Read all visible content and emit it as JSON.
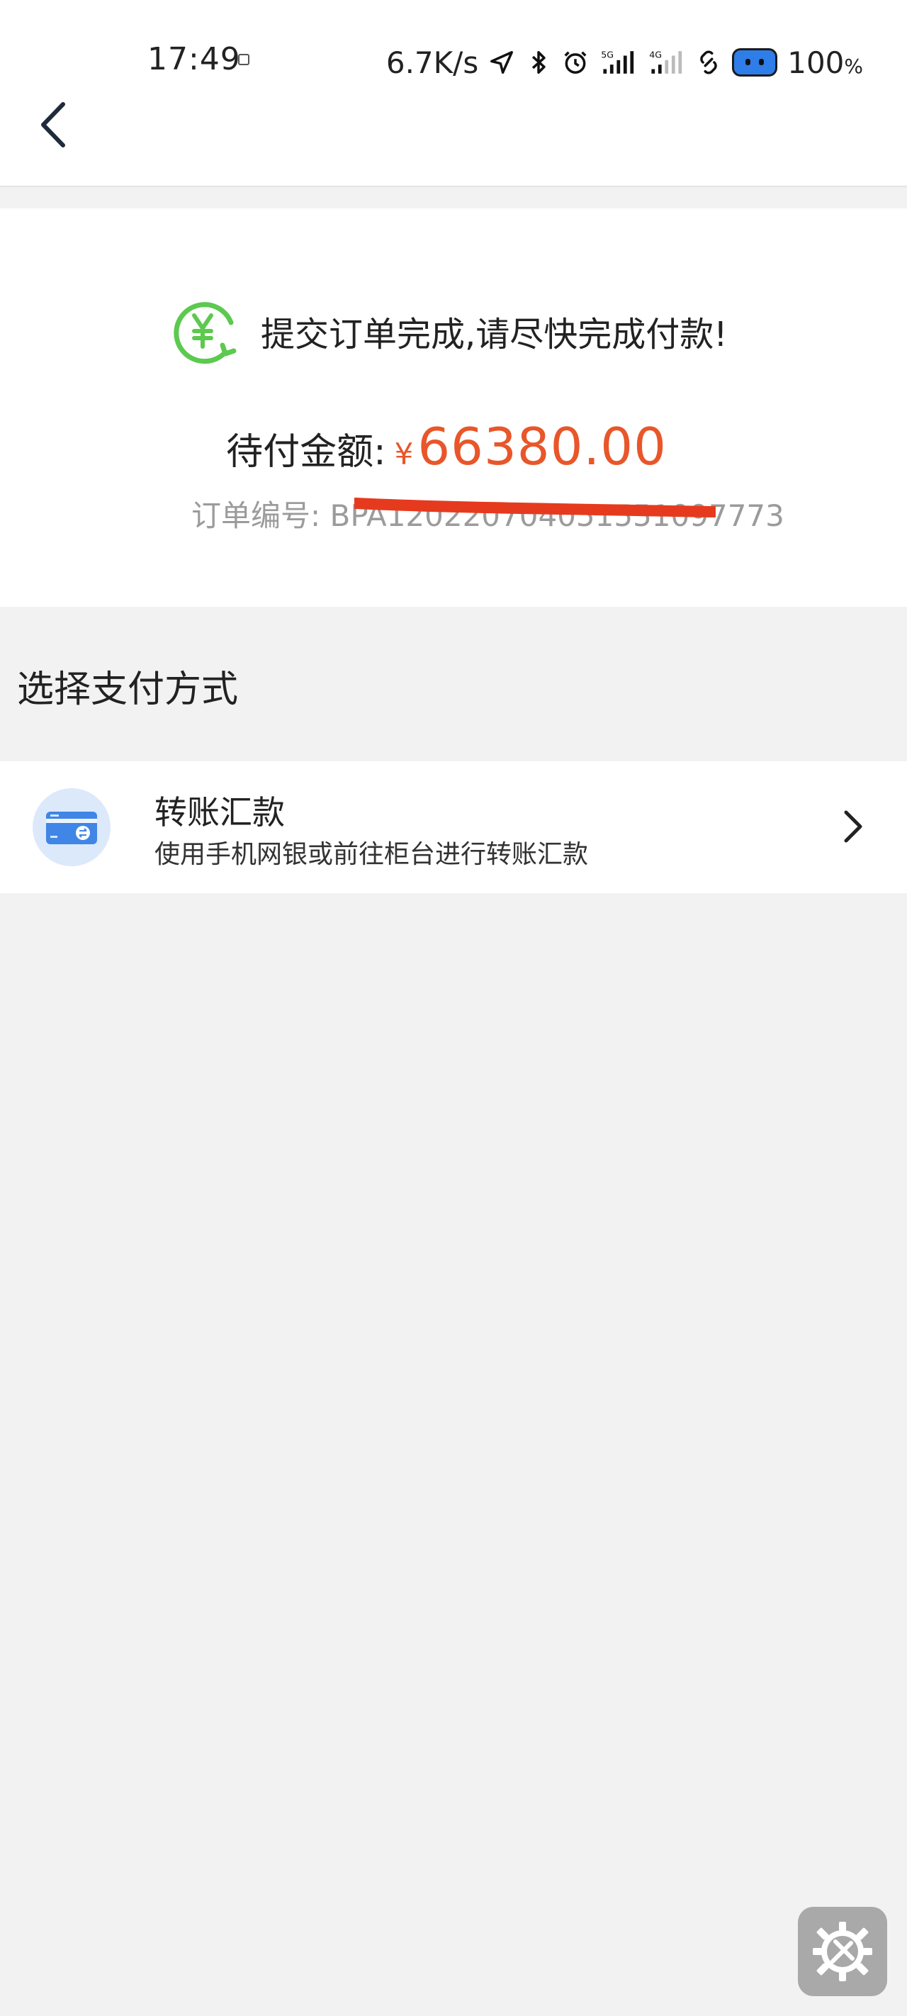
{
  "status_bar": {
    "time": "17:49",
    "network_speed": "6.7K/s",
    "battery": "100",
    "battery_unit": "%",
    "icons": [
      "location-arrow-icon",
      "bluetooth-icon",
      "alarm-icon",
      "signal-5g-icon",
      "signal-4g-icon",
      "link-icon",
      "battery-face-icon"
    ]
  },
  "header": {
    "back_icon": "chevron-left-icon"
  },
  "order_summary": {
    "success_icon": "yen-refresh-icon",
    "message": "提交订单完成,请尽快完成付款!",
    "amount_label": "待付金额:",
    "currency_symbol": "¥",
    "amount": "66380.00",
    "order_number_label": "订单编号:",
    "order_number_visible": "BPA120220704051551097773"
  },
  "payment": {
    "section_title": "选择支付方式",
    "methods": [
      {
        "icon": "bank-card-transfer-icon",
        "title": "转账汇款",
        "description": "使用手机网银或前往柜台进行转账汇款",
        "arrow_icon": "chevron-right-icon"
      }
    ]
  },
  "floating_button": {
    "icon": "settings-tools-icon"
  },
  "colors": {
    "accent_amount": "#e8562a",
    "success_green": "#5cc94f",
    "redaction_red": "#e63a1e",
    "background": "#f2f2f2"
  }
}
